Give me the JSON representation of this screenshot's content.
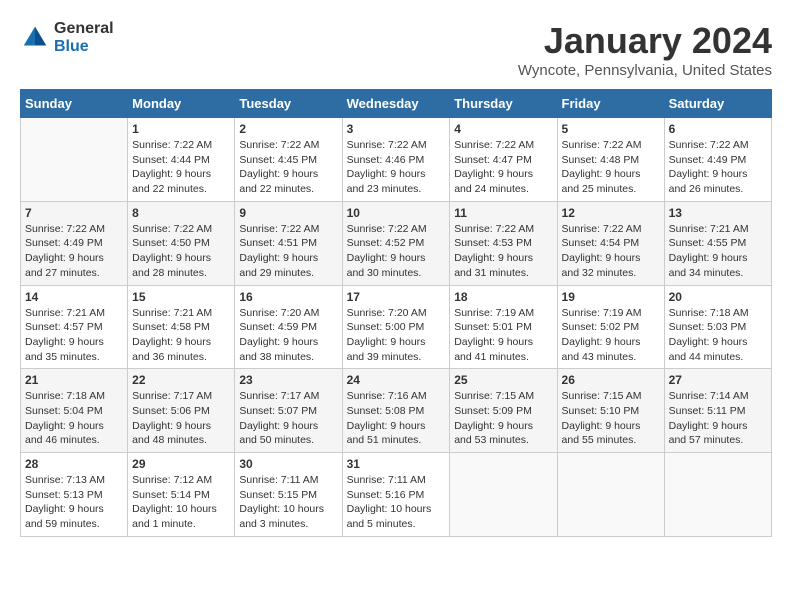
{
  "header": {
    "logo": {
      "general": "General",
      "blue": "Blue"
    },
    "title": "January 2024",
    "location": "Wyncote, Pennsylvania, United States"
  },
  "weekdays": [
    "Sunday",
    "Monday",
    "Tuesday",
    "Wednesday",
    "Thursday",
    "Friday",
    "Saturday"
  ],
  "weeks": [
    [
      {
        "day": "",
        "sunrise": "",
        "sunset": "",
        "daylight": ""
      },
      {
        "day": "1",
        "sunrise": "Sunrise: 7:22 AM",
        "sunset": "Sunset: 4:44 PM",
        "daylight": "Daylight: 9 hours and 22 minutes."
      },
      {
        "day": "2",
        "sunrise": "Sunrise: 7:22 AM",
        "sunset": "Sunset: 4:45 PM",
        "daylight": "Daylight: 9 hours and 22 minutes."
      },
      {
        "day": "3",
        "sunrise": "Sunrise: 7:22 AM",
        "sunset": "Sunset: 4:46 PM",
        "daylight": "Daylight: 9 hours and 23 minutes."
      },
      {
        "day": "4",
        "sunrise": "Sunrise: 7:22 AM",
        "sunset": "Sunset: 4:47 PM",
        "daylight": "Daylight: 9 hours and 24 minutes."
      },
      {
        "day": "5",
        "sunrise": "Sunrise: 7:22 AM",
        "sunset": "Sunset: 4:48 PM",
        "daylight": "Daylight: 9 hours and 25 minutes."
      },
      {
        "day": "6",
        "sunrise": "Sunrise: 7:22 AM",
        "sunset": "Sunset: 4:49 PM",
        "daylight": "Daylight: 9 hours and 26 minutes."
      }
    ],
    [
      {
        "day": "7",
        "sunrise": "Sunrise: 7:22 AM",
        "sunset": "Sunset: 4:49 PM",
        "daylight": "Daylight: 9 hours and 27 minutes."
      },
      {
        "day": "8",
        "sunrise": "Sunrise: 7:22 AM",
        "sunset": "Sunset: 4:50 PM",
        "daylight": "Daylight: 9 hours and 28 minutes."
      },
      {
        "day": "9",
        "sunrise": "Sunrise: 7:22 AM",
        "sunset": "Sunset: 4:51 PM",
        "daylight": "Daylight: 9 hours and 29 minutes."
      },
      {
        "day": "10",
        "sunrise": "Sunrise: 7:22 AM",
        "sunset": "Sunset: 4:52 PM",
        "daylight": "Daylight: 9 hours and 30 minutes."
      },
      {
        "day": "11",
        "sunrise": "Sunrise: 7:22 AM",
        "sunset": "Sunset: 4:53 PM",
        "daylight": "Daylight: 9 hours and 31 minutes."
      },
      {
        "day": "12",
        "sunrise": "Sunrise: 7:22 AM",
        "sunset": "Sunset: 4:54 PM",
        "daylight": "Daylight: 9 hours and 32 minutes."
      },
      {
        "day": "13",
        "sunrise": "Sunrise: 7:21 AM",
        "sunset": "Sunset: 4:55 PM",
        "daylight": "Daylight: 9 hours and 34 minutes."
      }
    ],
    [
      {
        "day": "14",
        "sunrise": "Sunrise: 7:21 AM",
        "sunset": "Sunset: 4:57 PM",
        "daylight": "Daylight: 9 hours and 35 minutes."
      },
      {
        "day": "15",
        "sunrise": "Sunrise: 7:21 AM",
        "sunset": "Sunset: 4:58 PM",
        "daylight": "Daylight: 9 hours and 36 minutes."
      },
      {
        "day": "16",
        "sunrise": "Sunrise: 7:20 AM",
        "sunset": "Sunset: 4:59 PM",
        "daylight": "Daylight: 9 hours and 38 minutes."
      },
      {
        "day": "17",
        "sunrise": "Sunrise: 7:20 AM",
        "sunset": "Sunset: 5:00 PM",
        "daylight": "Daylight: 9 hours and 39 minutes."
      },
      {
        "day": "18",
        "sunrise": "Sunrise: 7:19 AM",
        "sunset": "Sunset: 5:01 PM",
        "daylight": "Daylight: 9 hours and 41 minutes."
      },
      {
        "day": "19",
        "sunrise": "Sunrise: 7:19 AM",
        "sunset": "Sunset: 5:02 PM",
        "daylight": "Daylight: 9 hours and 43 minutes."
      },
      {
        "day": "20",
        "sunrise": "Sunrise: 7:18 AM",
        "sunset": "Sunset: 5:03 PM",
        "daylight": "Daylight: 9 hours and 44 minutes."
      }
    ],
    [
      {
        "day": "21",
        "sunrise": "Sunrise: 7:18 AM",
        "sunset": "Sunset: 5:04 PM",
        "daylight": "Daylight: 9 hours and 46 minutes."
      },
      {
        "day": "22",
        "sunrise": "Sunrise: 7:17 AM",
        "sunset": "Sunset: 5:06 PM",
        "daylight": "Daylight: 9 hours and 48 minutes."
      },
      {
        "day": "23",
        "sunrise": "Sunrise: 7:17 AM",
        "sunset": "Sunset: 5:07 PM",
        "daylight": "Daylight: 9 hours and 50 minutes."
      },
      {
        "day": "24",
        "sunrise": "Sunrise: 7:16 AM",
        "sunset": "Sunset: 5:08 PM",
        "daylight": "Daylight: 9 hours and 51 minutes."
      },
      {
        "day": "25",
        "sunrise": "Sunrise: 7:15 AM",
        "sunset": "Sunset: 5:09 PM",
        "daylight": "Daylight: 9 hours and 53 minutes."
      },
      {
        "day": "26",
        "sunrise": "Sunrise: 7:15 AM",
        "sunset": "Sunset: 5:10 PM",
        "daylight": "Daylight: 9 hours and 55 minutes."
      },
      {
        "day": "27",
        "sunrise": "Sunrise: 7:14 AM",
        "sunset": "Sunset: 5:11 PM",
        "daylight": "Daylight: 9 hours and 57 minutes."
      }
    ],
    [
      {
        "day": "28",
        "sunrise": "Sunrise: 7:13 AM",
        "sunset": "Sunset: 5:13 PM",
        "daylight": "Daylight: 9 hours and 59 minutes."
      },
      {
        "day": "29",
        "sunrise": "Sunrise: 7:12 AM",
        "sunset": "Sunset: 5:14 PM",
        "daylight": "Daylight: 10 hours and 1 minute."
      },
      {
        "day": "30",
        "sunrise": "Sunrise: 7:11 AM",
        "sunset": "Sunset: 5:15 PM",
        "daylight": "Daylight: 10 hours and 3 minutes."
      },
      {
        "day": "31",
        "sunrise": "Sunrise: 7:11 AM",
        "sunset": "Sunset: 5:16 PM",
        "daylight": "Daylight: 10 hours and 5 minutes."
      },
      {
        "day": "",
        "sunrise": "",
        "sunset": "",
        "daylight": ""
      },
      {
        "day": "",
        "sunrise": "",
        "sunset": "",
        "daylight": ""
      },
      {
        "day": "",
        "sunrise": "",
        "sunset": "",
        "daylight": ""
      }
    ]
  ]
}
